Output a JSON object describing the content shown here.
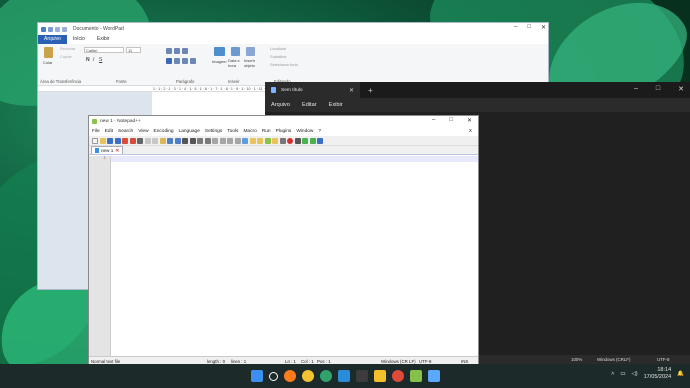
{
  "wordpad": {
    "title": "Documento - WordPad",
    "tabs": [
      "Arquivo",
      "Início",
      "Exibir"
    ],
    "clipboard": {
      "paste_label": "Colar",
      "cut_label": "Recortar",
      "copy_label": "Copiar",
      "group_label": "Área de Transferência"
    },
    "font": {
      "family": "Calibri",
      "size": "11",
      "group_label": "Fonte"
    },
    "paragraph": {
      "group_label": "Parágrafo"
    },
    "insert": {
      "image_label": "Imagem",
      "datetime_label": "Data e hora",
      "object_label": "Inserir objeto",
      "group_label": "Inserir"
    },
    "editing": {
      "find_label": "Localizar",
      "replace_label": "Substituir",
      "select_all_label": "Selecionar tudo",
      "group_label": "Editando"
    },
    "ruler_text": "1 · 1 · 2 · 1 · 3 · 1 · 4 · 1 · 5 · 1 · 6 · 1 · 7 · 1 · 8 · 1 · 9 · 1 · 10 · 1 · 11 · 1 · 12 · 1 · 13 · 1 · 14 · 1 · 15 · 1 · 16 · 1 · 17"
  },
  "notepad": {
    "tab_title": "Sem título",
    "menu": [
      "Arquivo",
      "Editar",
      "Exibir"
    ],
    "status": {
      "zoom": "100%",
      "line_ending": "Windows (CRLF)",
      "encoding": "UTF-8"
    }
  },
  "npp": {
    "title": "new 1 - Notepad++",
    "menu": [
      "File",
      "Edit",
      "Search",
      "View",
      "Encoding",
      "Language",
      "Settings",
      "Tools",
      "Macro",
      "Run",
      "Plugins",
      "Window",
      "?"
    ],
    "menu_close": "X",
    "tab_label": "new 1",
    "line_number": "1",
    "status": {
      "file_type": "Normal text file",
      "length": "length : 0",
      "lines": "lines : 1",
      "ln": "Ln : 1",
      "col": "Col : 1",
      "pos": "Pos : 1",
      "eol": "Windows (CR LF)",
      "encoding": "UTF-8",
      "mode": "INS"
    }
  },
  "taskbar": {
    "time": "18:14",
    "date": "17/05/2024",
    "icons": [
      "windows-start-icon",
      "search-icon",
      "firefox-icon",
      "chrome-icon",
      "edge-icon",
      "vscode-icon",
      "terminal-icon",
      "file-explorer-icon",
      "chrome-icon",
      "notepadpp-icon",
      "notepad-icon"
    ],
    "colors": [
      "#3a8ff0",
      "#ffffff",
      "#ff7b1c",
      "#f2c230",
      "#2fa36b",
      "#2a8cd8",
      "#3c3c3c",
      "#f4c02a",
      "#e04a3a",
      "#86c24a",
      "#5aa9ff"
    ]
  },
  "colors": {
    "accent": "#2b61b4",
    "dark_bg": "#202020"
  }
}
